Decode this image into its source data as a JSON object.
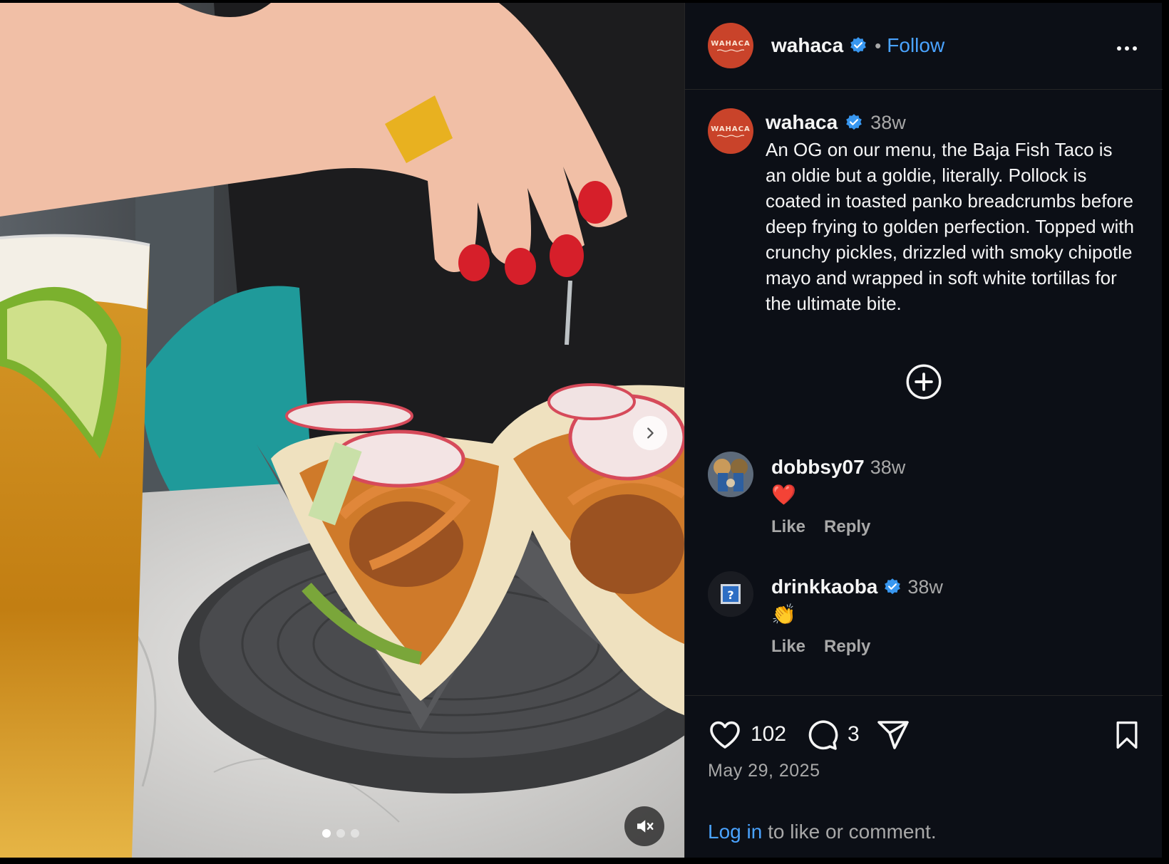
{
  "post": {
    "username": "wahaca",
    "follow_label": "Follow",
    "separator": "•",
    "avatar_text": "WAHACA",
    "caption_time": "38w",
    "caption": "An OG on our menu, the Baja Fish Taco is an oldie but a goldie, literally. Pollock is coated in toasted panko breadcrumbs before deep frying to golden perfection. Topped with crunchy pickles, drizzled with smoky chipotle mayo and wrapped in soft white tortillas for the ultimate bite."
  },
  "comments": [
    {
      "username": "dobbsy07",
      "time": "38w",
      "text": "❤️",
      "like_label": "Like",
      "reply_label": "Reply"
    },
    {
      "username": "drinkkaoba",
      "verified": true,
      "time": "38w",
      "text": "👏",
      "like_label": "Like",
      "reply_label": "Reply"
    }
  ],
  "actions": {
    "likes_count": "102",
    "comments_count": "3"
  },
  "date": "May 29, 2025",
  "login": {
    "link_text": "Log in",
    "rest_text": " to like or comment."
  },
  "media": {
    "carousel_total": 3,
    "carousel_active": 1
  },
  "colors": {
    "panel_bg": "#0c0f16",
    "link": "#4aa3ff",
    "verified": "#3897f0",
    "brand_avatar": "#c9432a",
    "muted_text": "#a8a8a8"
  },
  "icons": [
    "chevron-right-icon",
    "mute-icon",
    "verified-icon",
    "more-icon",
    "plus-circle-icon",
    "heart-icon",
    "comment-icon",
    "share-icon",
    "bookmark-icon"
  ]
}
